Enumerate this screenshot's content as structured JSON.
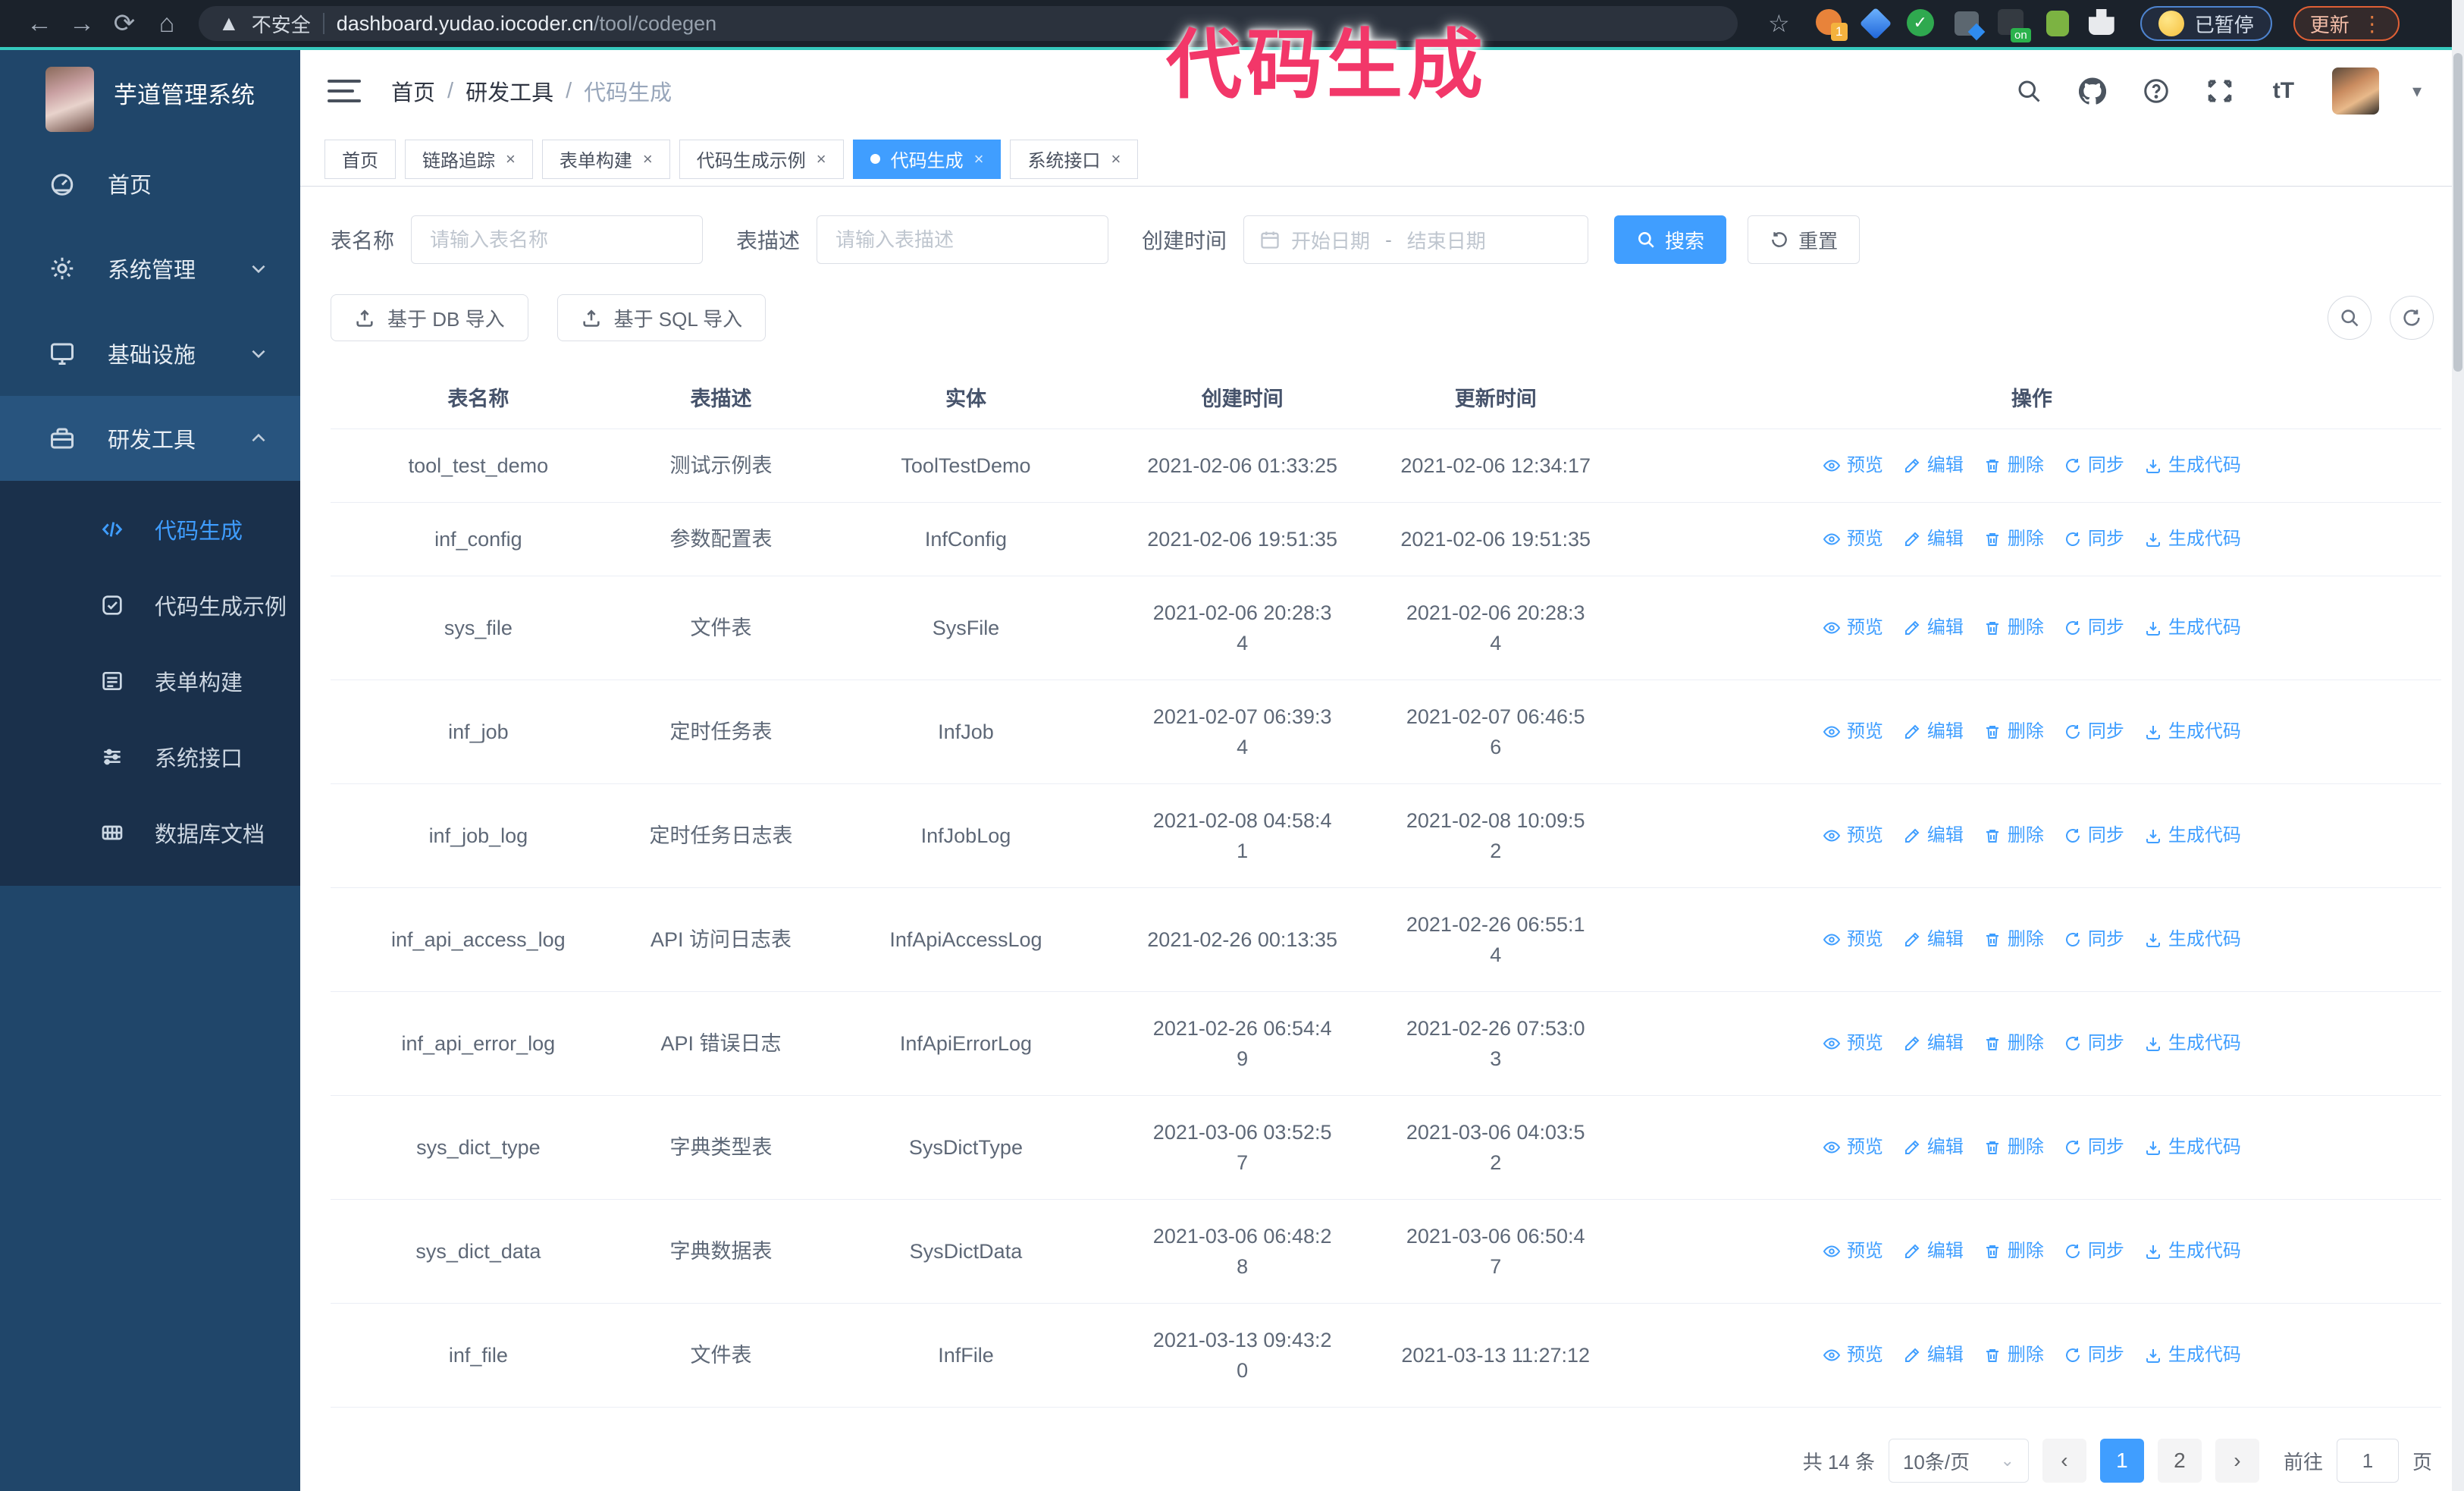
{
  "browser": {
    "security_label": "不安全",
    "url_host": "dashboard.yudao.iocoder.cn",
    "url_path": "/tool/codegen",
    "extension_badge": "1",
    "extension_on_badge": "on",
    "paused_badge": "已暂停",
    "update_badge": "更新"
  },
  "annotation": {
    "text": "代码生成",
    "color": "#f23769"
  },
  "sidebar": {
    "app_title": "芋道管理系统",
    "items": [
      {
        "label": "首页",
        "icon": "dashboard-icon",
        "chevron": "",
        "active": false
      },
      {
        "label": "系统管理",
        "icon": "gear-icon",
        "chevron": "down",
        "active": false
      },
      {
        "label": "基础设施",
        "icon": "monitor-icon",
        "chevron": "down",
        "active": false
      },
      {
        "label": "研发工具",
        "icon": "toolbox-icon",
        "chevron": "up",
        "active": true
      }
    ],
    "submenu": [
      {
        "label": "代码生成",
        "icon": "code-icon",
        "active": true
      },
      {
        "label": "代码生成示例",
        "icon": "example-icon",
        "active": false
      },
      {
        "label": "表单构建",
        "icon": "form-icon",
        "active": false
      },
      {
        "label": "系统接口",
        "icon": "api-icon",
        "active": false
      },
      {
        "label": "数据库文档",
        "icon": "database-icon",
        "active": false
      }
    ]
  },
  "header": {
    "breadcrumb": [
      "首页",
      "研发工具",
      "代码生成"
    ]
  },
  "tabs": [
    {
      "label": "首页",
      "closable": false,
      "active": false
    },
    {
      "label": "链路追踪",
      "closable": true,
      "active": false
    },
    {
      "label": "表单构建",
      "closable": true,
      "active": false
    },
    {
      "label": "代码生成示例",
      "closable": true,
      "active": false
    },
    {
      "label": "代码生成",
      "closable": true,
      "active": true
    },
    {
      "label": "系统接口",
      "closable": true,
      "active": false
    }
  ],
  "filters": {
    "name_label": "表名称",
    "name_placeholder": "请输入表名称",
    "desc_label": "表描述",
    "desc_placeholder": "请输入表描述",
    "time_label": "创建时间",
    "start_placeholder": "开始日期",
    "range_separator": "-",
    "end_placeholder": "结束日期",
    "search_label": "搜索",
    "reset_label": "重置"
  },
  "toolbar": {
    "import_db_label": "基于 DB 导入",
    "import_sql_label": "基于 SQL 导入"
  },
  "table": {
    "columns": [
      "表名称",
      "表描述",
      "实体",
      "创建时间",
      "更新时间",
      "操作"
    ],
    "actions": [
      {
        "label": "预览",
        "icon": "eye-icon"
      },
      {
        "label": "编辑",
        "icon": "pencil-icon"
      },
      {
        "label": "删除",
        "icon": "trash-icon"
      },
      {
        "label": "同步",
        "icon": "sync-icon"
      },
      {
        "label": "生成代码",
        "icon": "download-icon"
      }
    ],
    "rows": [
      {
        "name": "tool_test_demo",
        "desc": "测试示例表",
        "entity": "ToolTestDemo",
        "created": "2021-02-06 01:33:25",
        "updated": "2021-02-06 12:34:17"
      },
      {
        "name": "inf_config",
        "desc": "参数配置表",
        "entity": "InfConfig",
        "created": "2021-02-06 19:51:35",
        "updated": "2021-02-06 19:51:35"
      },
      {
        "name": "sys_file",
        "desc": "文件表",
        "entity": "SysFile",
        "created": "2021-02-06 20:28:3\n4",
        "updated": "2021-02-06 20:28:3\n4"
      },
      {
        "name": "inf_job",
        "desc": "定时任务表",
        "entity": "InfJob",
        "created": "2021-02-07 06:39:3\n4",
        "updated": "2021-02-07 06:46:5\n6"
      },
      {
        "name": "inf_job_log",
        "desc": "定时任务日志表",
        "entity": "InfJobLog",
        "created": "2021-02-08 04:58:4\n1",
        "updated": "2021-02-08 10:09:5\n2"
      },
      {
        "name": "inf_api_access_log",
        "desc": "API 访问日志表",
        "entity": "InfApiAccessLog",
        "created": "2021-02-26 00:13:35",
        "updated": "2021-02-26 06:55:1\n4"
      },
      {
        "name": "inf_api_error_log",
        "desc": "API 错误日志",
        "entity": "InfApiErrorLog",
        "created": "2021-02-26 06:54:4\n9",
        "updated": "2021-02-26 07:53:0\n3"
      },
      {
        "name": "sys_dict_type",
        "desc": "字典类型表",
        "entity": "SysDictType",
        "created": "2021-03-06 03:52:5\n7",
        "updated": "2021-03-06 04:03:5\n2"
      },
      {
        "name": "sys_dict_data",
        "desc": "字典数据表",
        "entity": "SysDictData",
        "created": "2021-03-06 06:48:2\n8",
        "updated": "2021-03-06 06:50:4\n7"
      },
      {
        "name": "inf_file",
        "desc": "文件表",
        "entity": "InfFile",
        "created": "2021-03-13 09:43:2\n0",
        "updated": "2021-03-13 11:27:12"
      }
    ]
  },
  "pagination": {
    "total_text": "共 14 条",
    "page_size": "10条/页",
    "pages": [
      "1",
      "2"
    ],
    "active_page": "1",
    "goto_label": "前往",
    "goto_value": "1",
    "page_suffix": "页"
  },
  "colors": {
    "accent": "#409eff",
    "annotation": "#f23769",
    "sidebar_bg": "#20466a",
    "submenu_bg": "#1a304b"
  }
}
